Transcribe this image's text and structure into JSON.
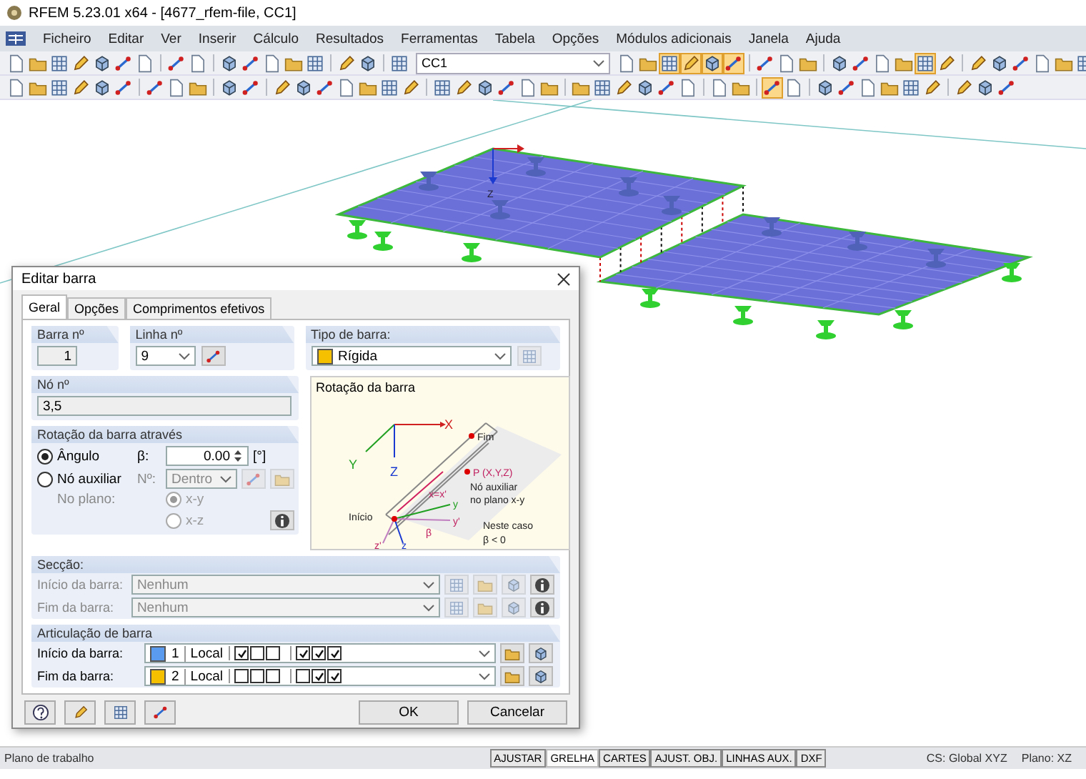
{
  "window": {
    "title": "RFEM 5.23.01 x64 - [4677_rfem-file, CC1]"
  },
  "menu": [
    "Ficheiro",
    "Editar",
    "Ver",
    "Inserir",
    "Cálculo",
    "Resultados",
    "Ferramentas",
    "Tabela",
    "Opções",
    "Módulos adicionais",
    "Janela",
    "Ajuda"
  ],
  "toolbar_1": {
    "left": [
      {
        "buttons": [
          {
            "selected": false
          },
          {
            "selected": false
          },
          {
            "selected": false
          },
          {
            "selected": false
          },
          {
            "selected": false
          },
          {
            "selected": false
          },
          {
            "selected": false
          }
        ]
      },
      {
        "buttons": [
          {
            "selected": false
          },
          {
            "selected": false
          }
        ]
      },
      {
        "buttons": [
          {
            "selected": false
          },
          {
            "selected": false
          },
          {
            "selected": false
          },
          {
            "selected": false
          },
          {
            "selected": false
          }
        ]
      },
      {
        "buttons": [
          {
            "selected": false
          },
          {
            "selected": false
          }
        ]
      },
      {
        "buttons": [
          {
            "selected": false
          }
        ]
      }
    ],
    "load_case": "CC1",
    "right": [
      {
        "buttons": [
          {
            "selected": false
          },
          {
            "selected": false
          },
          {
            "selected": true
          },
          {
            "selected": true
          },
          {
            "selected": true
          },
          {
            "selected": true
          }
        ]
      },
      {
        "buttons": [
          {
            "selected": false
          },
          {
            "selected": false
          },
          {
            "selected": false
          }
        ]
      },
      {
        "buttons": [
          {
            "selected": false
          },
          {
            "selected": false
          },
          {
            "selected": false
          },
          {
            "selected": false
          },
          {
            "selected": true
          },
          {
            "selected": false
          }
        ]
      },
      {
        "buttons": [
          {
            "selected": false
          },
          {
            "selected": false
          },
          {
            "selected": false
          },
          {
            "selected": false
          },
          {
            "selected": false
          },
          {
            "selected": false
          }
        ]
      }
    ]
  },
  "toolbar_2": [
    {
      "buttons": [
        {
          "selected": false
        },
        {
          "selected": false
        },
        {
          "selected": false
        },
        {
          "selected": false
        },
        {
          "selected": false
        },
        {
          "selected": false
        }
      ]
    },
    {
      "buttons": [
        {
          "selected": false
        },
        {
          "selected": false
        },
        {
          "selected": false
        }
      ]
    },
    {
      "buttons": [
        {
          "selected": false
        },
        {
          "selected": false
        }
      ]
    },
    {
      "buttons": [
        {
          "selected": false
        },
        {
          "selected": false
        },
        {
          "selected": false
        },
        {
          "selected": false
        },
        {
          "selected": false
        },
        {
          "selected": false
        },
        {
          "selected": false
        }
      ]
    },
    {
      "buttons": [
        {
          "selected": false
        },
        {
          "selected": false
        },
        {
          "selected": false
        },
        {
          "selected": false
        },
        {
          "selected": false
        },
        {
          "selected": false
        }
      ]
    },
    {
      "buttons": [
        {
          "selected": false
        },
        {
          "selected": false
        },
        {
          "selected": false
        },
        {
          "selected": false
        },
        {
          "selected": false
        },
        {
          "selected": false
        }
      ]
    },
    {
      "buttons": [
        {
          "selected": false
        },
        {
          "selected": false
        }
      ]
    },
    {
      "buttons": [
        {
          "selected": true
        },
        {
          "selected": false
        }
      ]
    },
    {
      "buttons": [
        {
          "selected": false
        },
        {
          "selected": false
        },
        {
          "selected": false
        },
        {
          "selected": false
        },
        {
          "selected": false
        },
        {
          "selected": false
        }
      ]
    },
    {
      "buttons": [
        {
          "selected": false
        },
        {
          "selected": false
        },
        {
          "selected": false
        }
      ]
    }
  ],
  "viewport": {
    "axis_label": "Z"
  },
  "dialog": {
    "title": "Editar barra",
    "tabs": [
      {
        "label": "Geral",
        "selected": true
      },
      {
        "label": "Opções",
        "selected": false
      },
      {
        "label": "Comprimentos efetivos",
        "selected": false
      }
    ],
    "bar_number": {
      "label": "Barra nº",
      "value": "1"
    },
    "line_number": {
      "label": "Linha nº",
      "value": "9"
    },
    "bar_type": {
      "label": "Tipo de barra:",
      "value": "Rígida"
    },
    "nodes": {
      "label": "Nó nº",
      "value": "3,5"
    },
    "rotation": {
      "title": "Rotação da barra através",
      "options": [
        {
          "label": "Ângulo",
          "selected": true
        },
        {
          "label": "Nó auxiliar",
          "selected": false
        }
      ],
      "angle": {
        "label": "β:",
        "value": "0.00",
        "unit": "[°]"
      },
      "aux_node": {
        "label": "Nº:",
        "value": "Dentro",
        "disabled": true
      },
      "plane": {
        "label": "No plano:",
        "disabled": true,
        "options": [
          {
            "label": "x-y",
            "selected": true
          },
          {
            "label": "x-z",
            "selected": false
          }
        ]
      }
    },
    "diagram": {
      "title": "Rotação da barra",
      "labels": [
        "X",
        "Y",
        "Z",
        "Fim",
        "P (X,Y,Z)",
        "Nó auxiliar",
        "no plano x-y",
        "Início",
        "x=x'",
        "y",
        "y'",
        "β",
        "z'",
        "z",
        "Neste caso",
        "β < 0"
      ]
    },
    "section": {
      "title": "Secção:",
      "disabled": true,
      "rows": [
        {
          "label": "Início da barra:",
          "value": "Nenhum"
        },
        {
          "label": "Fim da barra:",
          "value": "Nenhum"
        }
      ]
    },
    "hinges": {
      "title": "Articulação de barra",
      "rows": [
        {
          "label": "Início da barra:",
          "color": "#5b9bef",
          "number": "1",
          "system": "Local",
          "checks_1": [
            true,
            false,
            false
          ],
          "checks_2": [
            true,
            true,
            true
          ]
        },
        {
          "label": "Fim da barra:",
          "color": "#f5c000",
          "number": "2",
          "system": "Local",
          "checks_1": [
            false,
            false,
            false
          ],
          "checks_2": [
            false,
            true,
            true
          ]
        }
      ]
    },
    "buttons": [
      "OK",
      "Cancelar"
    ]
  },
  "status_bar": {
    "text": "Plano de trabalho",
    "toggles": [
      {
        "label": "AJUSTAR",
        "selected": false
      },
      {
        "label": "GRELHA",
        "selected": true
      },
      {
        "label": "CARTES",
        "selected": false
      },
      {
        "label": "AJUST. OBJ.",
        "selected": false
      },
      {
        "label": "LINHAS AUX.",
        "selected": false
      },
      {
        "label": "DXF",
        "selected": false
      }
    ],
    "cs": "CS: Global XYZ",
    "plane": "Plano: XZ"
  }
}
